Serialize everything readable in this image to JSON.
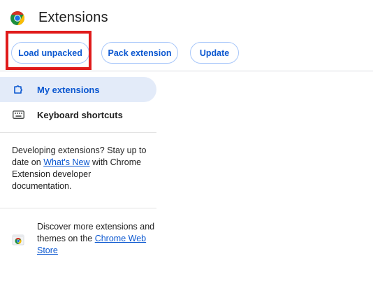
{
  "header": {
    "title": "Extensions",
    "logo_icon": "chrome-logo-icon"
  },
  "toolbar": {
    "load_unpacked_label": "Load unpacked",
    "pack_extension_label": "Pack extension",
    "update_label": "Update"
  },
  "sidebar": {
    "items": [
      {
        "label": "My extensions",
        "icon": "extension-puzzle-icon",
        "active": true
      },
      {
        "label": "Keyboard shortcuts",
        "icon": "keyboard-icon",
        "active": false
      }
    ],
    "dev_info": {
      "text_before": "Developing extensions? Stay up to date on ",
      "link": "What's New",
      "text_after": " with Chrome Extension developer documentation."
    },
    "store": {
      "icon": "chrome-web-store-icon",
      "text": "Discover more extensions and themes on the ",
      "link": "Chrome Web Store"
    }
  },
  "colors": {
    "accent": "#0b57d0",
    "active_bg": "#e3ebf9",
    "highlight_box": "#e01b1b"
  }
}
